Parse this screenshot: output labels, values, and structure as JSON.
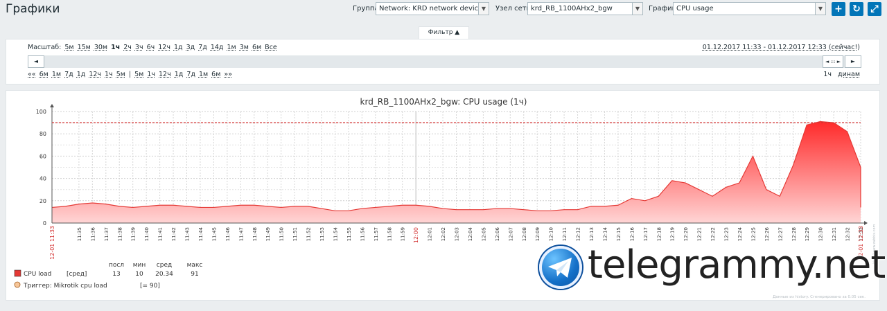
{
  "header": {
    "title": "Графики",
    "group_label": "Группа",
    "group_value": "Network: KRD network devices",
    "host_label": "Узел сети",
    "host_value": "krd_RB_1100AHx2_bgw",
    "graph_label": "График",
    "graph_value": "CPU usage",
    "buttons": [
      "+",
      "↻",
      "⤢"
    ]
  },
  "filter": {
    "tab_label": "Фильтр ▲",
    "zoom_label": "Масштаб:",
    "zoom_options": [
      "5м",
      "15м",
      "30м",
      "1ч",
      "2ч",
      "3ч",
      "6ч",
      "12ч",
      "1д",
      "3д",
      "7д",
      "14д",
      "1м",
      "3м",
      "6м",
      "Все"
    ],
    "zoom_active": "1ч",
    "period": "01.12.2017 11:33 - 01.12.2017 12:33 (сейчас!)",
    "nav_back": [
      "««",
      "6м",
      "1м",
      "7д",
      "1д",
      "12ч",
      "1ч",
      "5м"
    ],
    "nav_sep": "|",
    "nav_fwd": [
      "5м",
      "1ч",
      "12ч",
      "1д",
      "7д",
      "1м",
      "6м",
      "»»"
    ],
    "fixed_label": "1ч",
    "dynamic_label": "динам",
    "scroll_left": "◄",
    "scroll_right": "►",
    "scroll_handle": "◄ ::: ►"
  },
  "chart_data": {
    "type": "area",
    "title": "krd_RB_1100AHx2_bgw: CPU usage (1ч)",
    "ylim": [
      0,
      100
    ],
    "yticks": [
      0,
      20,
      40,
      60,
      80,
      100
    ],
    "x_start_label": "12-01 11:33",
    "x_mid_label": "12:00",
    "x_end_label": "12-01 12:33",
    "x_tick_labels": [
      "11:35",
      "11:36",
      "11:37",
      "11:38",
      "11:39",
      "11:40",
      "11:41",
      "11:42",
      "11:43",
      "11:44",
      "11:45",
      "11:46",
      "11:47",
      "11:48",
      "11:49",
      "11:50",
      "11:51",
      "11:52",
      "11:53",
      "11:54",
      "11:55",
      "11:56",
      "11:57",
      "11:58",
      "11:59",
      "12:01",
      "12:02",
      "12:03",
      "12:04",
      "12:05",
      "12:06",
      "12:07",
      "12:08",
      "12:09",
      "12:10",
      "12:11",
      "12:12",
      "12:13",
      "12:14",
      "12:15",
      "12:16",
      "12:17",
      "12:18",
      "12:19",
      "12:20",
      "12:21",
      "12:22",
      "12:23",
      "12:24",
      "12:25",
      "12:26",
      "12:27",
      "12:28",
      "12:29",
      "12:30",
      "12:31",
      "12:32",
      "12:33"
    ],
    "series": [
      {
        "name": "CPU load",
        "color": "#e53935",
        "x_minutes": [
          0,
          1,
          2,
          3,
          4,
          5,
          6,
          7,
          8,
          9,
          10,
          11,
          12,
          13,
          14,
          15,
          16,
          17,
          18,
          19,
          20,
          21,
          22,
          23,
          24,
          25,
          26,
          27,
          28,
          29,
          30,
          31,
          32,
          33,
          34,
          35,
          36,
          37,
          38,
          39,
          40,
          41,
          42,
          43,
          44,
          45,
          46,
          47,
          48,
          49,
          50,
          51,
          52,
          53,
          54,
          55,
          56,
          57,
          58,
          59,
          60
        ],
        "values": [
          14,
          15,
          17,
          18,
          17,
          15,
          14,
          15,
          16,
          16,
          15,
          14,
          14,
          15,
          16,
          16,
          15,
          14,
          15,
          15,
          13,
          11,
          11,
          13,
          14,
          15,
          16,
          16,
          15,
          13,
          12,
          12,
          12,
          13,
          13,
          12,
          11,
          11,
          12,
          12,
          13,
          13,
          12,
          12,
          13,
          13,
          12,
          12,
          13,
          12,
          12,
          11,
          11,
          12,
          13,
          12,
          11,
          11,
          13,
          13,
          14
        ]
      }
    ],
    "peak_segment": {
      "x_minutes": [
        40,
        41,
        42,
        43,
        44,
        45,
        46,
        47,
        48,
        49,
        50,
        51,
        52,
        53,
        54,
        55,
        56,
        57,
        58,
        59,
        60
      ],
      "values": [
        15,
        15,
        16,
        22,
        20,
        24,
        38,
        36,
        30,
        24,
        32,
        36,
        60,
        30,
        24,
        52,
        88,
        91,
        90,
        82,
        50
      ]
    },
    "trigger": {
      "name": "Триггер: Mikrotik cpu load",
      "value": 90,
      "cond": "[= 90]",
      "color": "#d32f2f"
    },
    "legend": {
      "headers": [
        "посл",
        "мин",
        "сред",
        "макс"
      ],
      "rows": [
        {
          "name": "CPU load",
          "agg": "[сред]",
          "last": "13",
          "min": "10",
          "avg": "20.34",
          "max": "91"
        }
      ]
    },
    "side_note": "http://www.zabbix.com",
    "footnote": "Данные из history. Сгенерировано за 0.05 сек."
  },
  "watermark": {
    "text": "telegrammy.net"
  }
}
